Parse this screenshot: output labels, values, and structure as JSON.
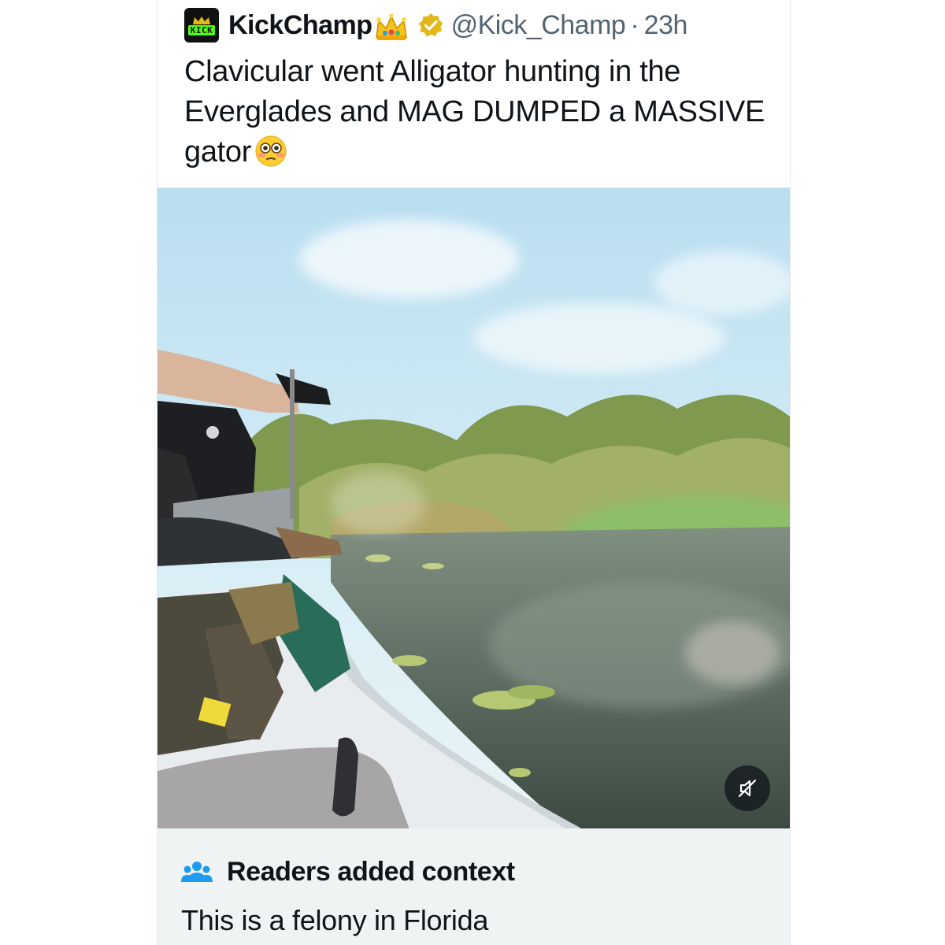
{
  "post": {
    "display_name": "KickChamp",
    "avatar_text": "KICK",
    "handle": "@Kick_Champ",
    "separator": "·",
    "timestamp": "23h",
    "text": "Clavicular went Alligator hunting in the Everglades and MAG DUMPED a MASSIVE gator",
    "emoji": "flushed-face-emoji",
    "name_emoji": "crown-emoji",
    "verified_icon": "verified-badge-icon"
  },
  "media": {
    "type": "video",
    "mute_icon": "muted-speaker-icon"
  },
  "community_note": {
    "icon": "people-icon",
    "title": "Readers added context",
    "body": "This is a felony in Florida"
  },
  "colors": {
    "text": "#0f1419",
    "secondary": "#536471",
    "verified_gold": "#e2b719",
    "note_background": "#eff3f4",
    "note_icon": "#1d9bf0",
    "kick_green": "#53fc18"
  }
}
